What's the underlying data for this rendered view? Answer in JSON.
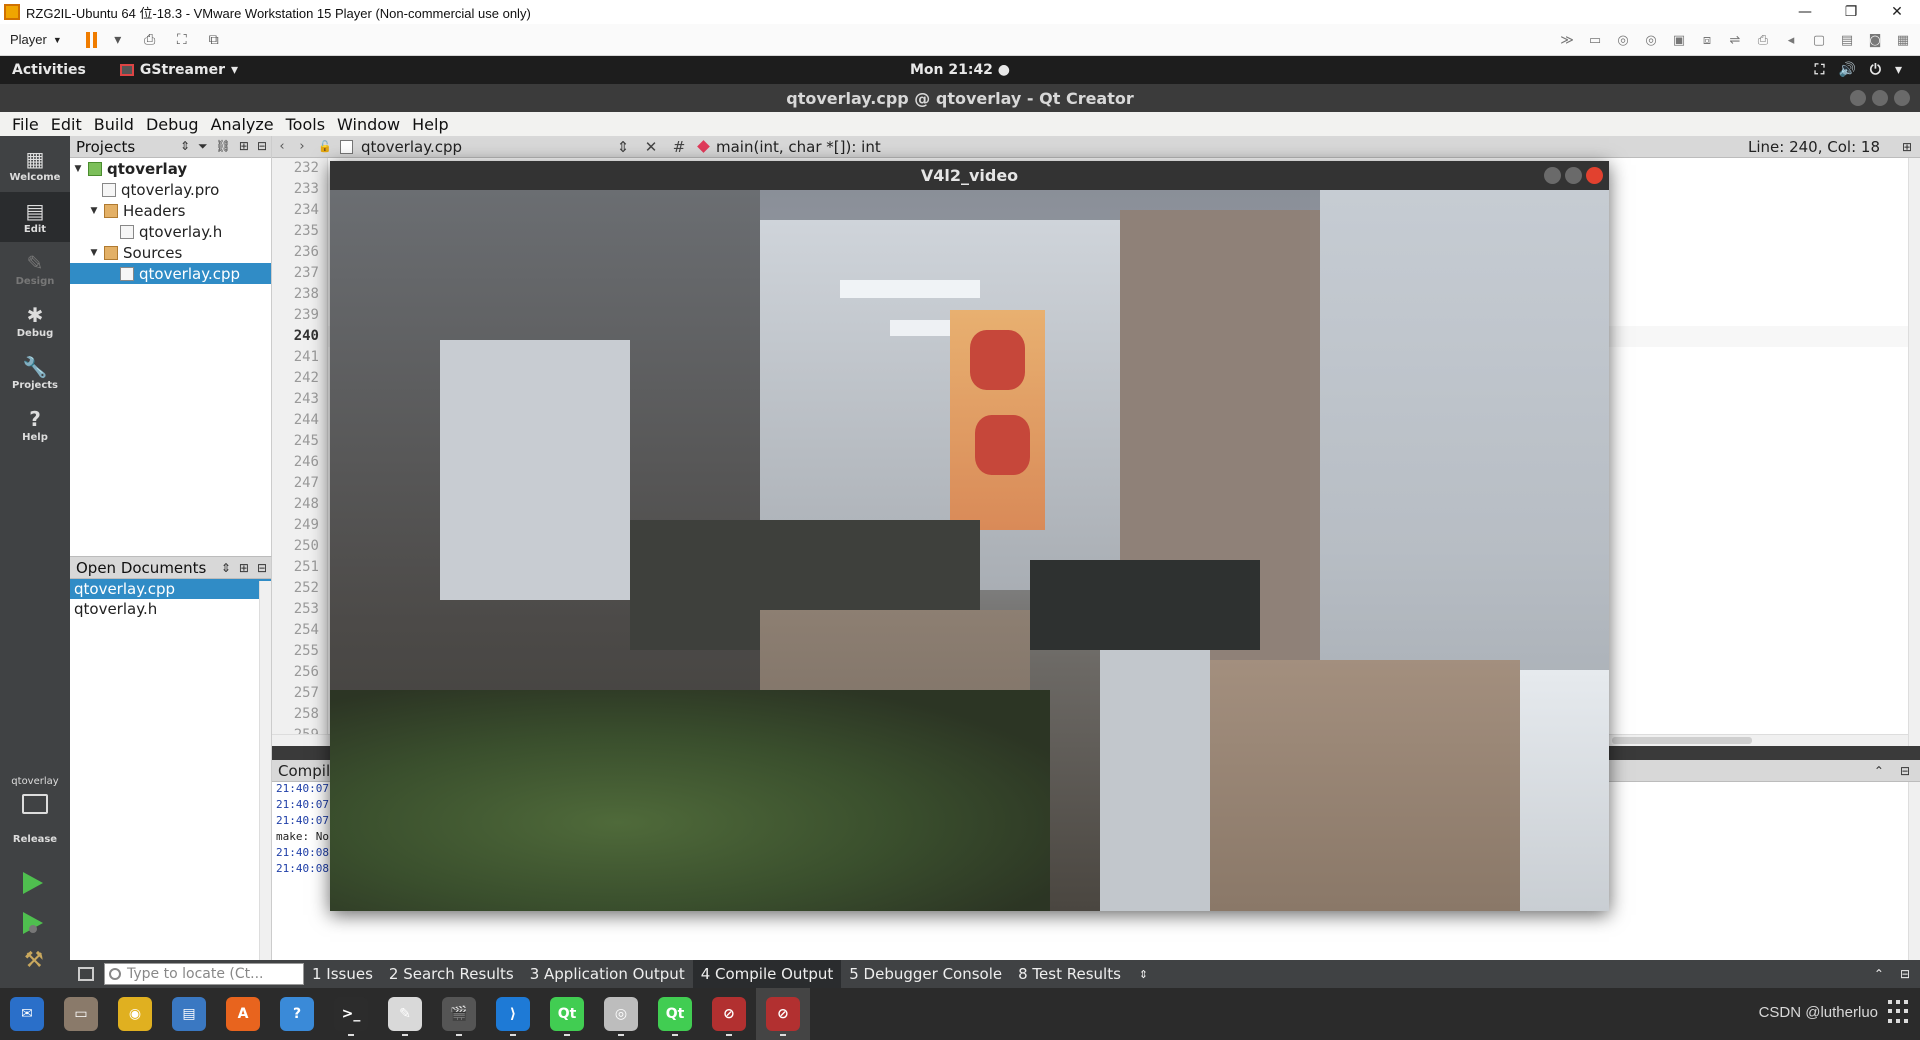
{
  "vmware": {
    "title": "RZG2IL-Ubuntu 64 位-18.3 - VMware Workstation 15 Player (Non-commercial use only)",
    "player_menu": "Player",
    "minimize_glyph": "—",
    "restore_glyph": "❐",
    "close_glyph": "✕"
  },
  "gnome": {
    "activities": "Activities",
    "app_menu": "GStreamer",
    "clock": "Mon 21:42 ●",
    "tray_glyphs": [
      "⛶",
      "🔊",
      "⏻",
      "▾"
    ]
  },
  "qt": {
    "window_title": "qtoverlay.cpp @ qtoverlay - Qt Creator",
    "menu": [
      "File",
      "Edit",
      "Build",
      "Debug",
      "Analyze",
      "Tools",
      "Window",
      "Help"
    ],
    "modes": [
      {
        "label": "Welcome",
        "glyph": "▦"
      },
      {
        "label": "Edit",
        "glyph": "▤"
      },
      {
        "label": "Design",
        "glyph": "✎"
      },
      {
        "label": "Debug",
        "glyph": "✱"
      },
      {
        "label": "Projects",
        "glyph": "🔧"
      },
      {
        "label": "Help",
        "glyph": "?"
      }
    ],
    "kit": {
      "project": "qtoverlay",
      "mode": "Release"
    },
    "projects_panel": {
      "title": "Projects",
      "tree": [
        {
          "label": "qtoverlay",
          "level": 0,
          "icon": "project-folder-icon"
        },
        {
          "label": "qtoverlay.pro",
          "level": 1,
          "icon": "pro-file-icon"
        },
        {
          "label": "Headers",
          "level": 1,
          "icon": "folder-icon"
        },
        {
          "label": "qtoverlay.h",
          "level": 2,
          "icon": "header-file-icon"
        },
        {
          "label": "Sources",
          "level": 1,
          "icon": "folder-icon"
        },
        {
          "label": "qtoverlay.cpp",
          "level": 2,
          "icon": "cpp-file-icon",
          "selected": true
        }
      ]
    },
    "open_documents": {
      "title": "Open Documents",
      "items": [
        "qtoverlay.cpp",
        "qtoverlay.h"
      ]
    },
    "editor_toolbar": {
      "file": "qtoverlay.cpp",
      "hash": "#",
      "symbol": "main(int, char *[]): int",
      "position": "Line: 240, Col: 18"
    },
    "line_numbers": [
      "232",
      "233",
      "234",
      "235",
      "236",
      "237",
      "238",
      "239",
      "240",
      "241",
      "242",
      "243",
      "244",
      "245",
      "246",
      "247",
      "248",
      "249",
      "250",
      "251",
      "252",
      "253",
      "254",
      "255",
      "256",
      "257",
      "258",
      "259"
    ],
    "current_line": "240",
    "output": {
      "title": "Compile Output",
      "lines": [
        "21:40:07",
        "21:40:07",
        "21:40:07",
        "make: No",
        "21:40:08",
        "21:40:08"
      ]
    },
    "locator_placeholder": "Type to locate (Ct...",
    "output_tabs": [
      "1  Issues",
      "2  Search Results",
      "3  Application Output",
      "4  Compile Output",
      "5  Debugger Console",
      "8  Test Results"
    ],
    "active_output_tab": "4  Compile Output"
  },
  "video_window": {
    "title": "V4l2_video"
  },
  "taskbar": {
    "apps": [
      {
        "name": "thunderbird",
        "glyph": "✉",
        "color": "#2a6fc9"
      },
      {
        "name": "files",
        "glyph": "▭",
        "color": "#8a7a6a"
      },
      {
        "name": "rhythmbox",
        "glyph": "◉",
        "color": "#e0b020"
      },
      {
        "name": "libreoffice-writer",
        "glyph": "▤",
        "color": "#3a78c2"
      },
      {
        "name": "software-center",
        "glyph": "A",
        "color": "#e8641e"
      },
      {
        "name": "help",
        "glyph": "?",
        "color": "#3a8ad8"
      },
      {
        "name": "terminal",
        "glyph": ">_",
        "color": "#2c2c2c"
      },
      {
        "name": "text-editor",
        "glyph": "✎",
        "color": "#d9d9d9"
      },
      {
        "name": "video-editor",
        "glyph": "🎬",
        "color": "#555555"
      },
      {
        "name": "vscode",
        "glyph": "⟩",
        "color": "#1e7ad6"
      },
      {
        "name": "qt-creator",
        "glyph": "Qt",
        "color": "#41cd52"
      },
      {
        "name": "camera",
        "glyph": "◎",
        "color": "#bdbdbd"
      },
      {
        "name": "qt-designer",
        "glyph": "Qt",
        "color": "#41cd52"
      },
      {
        "name": "app-red-1",
        "glyph": "⊘",
        "color": "#b23030"
      },
      {
        "name": "app-red-2",
        "glyph": "⊘",
        "color": "#b23030"
      }
    ],
    "watermark": "CSDN @lutherluo"
  },
  "colors": {
    "selection": "#308cc6",
    "qt_dark": "#404244",
    "close_red": "#e2412f"
  }
}
